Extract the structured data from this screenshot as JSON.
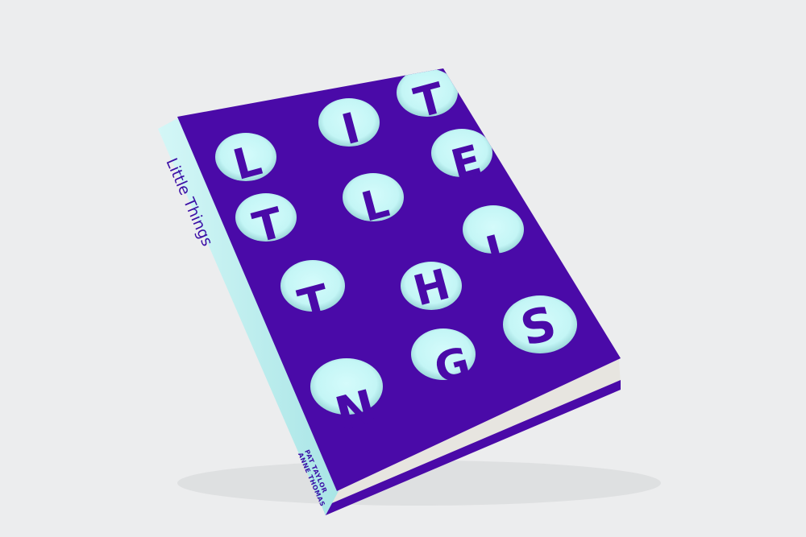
{
  "book": {
    "spine_title": "Little Things",
    "spine_authors": [
      "PAT TAYLOR",
      "ANNE THOMAS"
    ],
    "cover_letters": [
      "L",
      "I",
      "T",
      "T",
      "L",
      "E",
      "T",
      "H",
      "I",
      "N",
      "G",
      "S"
    ]
  },
  "colors": {
    "background": "#ecedee",
    "cover": "#4a0aa8",
    "spine": "#bff2f2",
    "hole": "#c4f6f6",
    "text": "#3b0fa6"
  }
}
